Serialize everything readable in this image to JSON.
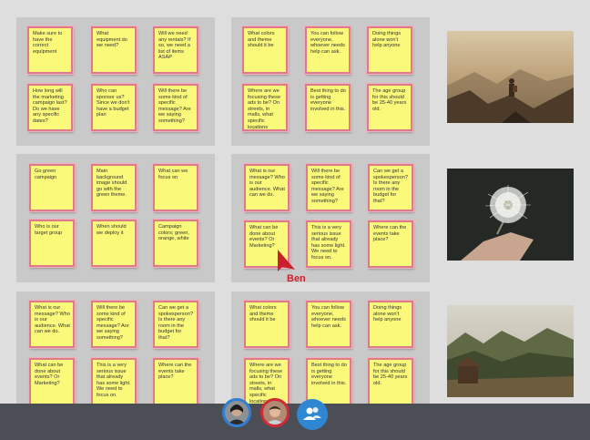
{
  "board": {
    "panels": [
      {
        "notes": [
          "Make sure to have the correct equipment",
          "What equipment do we need?",
          "Will we need any rentals? If so, we need a list of items ASAP",
          "How long will the marketing campaign last? Do we have any specific dates?",
          "Who can sponsor us? Since we don't have a budget plan",
          "Will there be some kind of specific message? Are we saying something?"
        ]
      },
      {
        "notes": [
          "What colors and theme should it be",
          "You can follow everyone, whoever needs help can ask.",
          "Doing things alone won't help anyone",
          "Where are we focusing these ads to be? On streets, in malls, what specific locations",
          "Best thing to do is getting everyone involved in this.",
          "The age group for this should be 25-40 years old."
        ]
      },
      {
        "notes": [
          "Go green campaign",
          "Main background image should go with the green theme.",
          "What can we focus on",
          "Who is our target group",
          "When should we deploy it",
          "Campaign colors; green, orange, white"
        ]
      },
      {
        "notes": [
          "What is our message? Who is our audience. What can we do.",
          "Will there be some kind of specific message? Are we saying something?",
          "Can we get a spokesperson? Is there any room in the budget for that?",
          "What can be done about events? Or Marketing?",
          "This is a very serious issue that already has some light. We need to focus on.",
          "Where can the events take place?"
        ]
      },
      {
        "notes": [
          "What is our message? Who is our audience. What can we do.",
          "Will there be some kind of specific message? Are we saying something?",
          "Can we get a spokesperson? Is there any room in the budget for that?",
          "What can be done about events? Or Marketing?",
          "This is a very serious issue that already has some light. We need to focus on.",
          "Where can the events take place?"
        ]
      },
      {
        "notes": [
          "What colors and theme should it be",
          "You can follow everyone, whoever needs help can ask.",
          "Doing things alone won't help anyone",
          "Where are we focusing these ads to be? On streets, in malls, what specific locations",
          "Best thing to do is getting everyone involved in this.",
          "The age group for this should be 25-40 years old."
        ]
      }
    ],
    "photos": [
      "mountain-hiker-photo",
      "dandelion-photo",
      "forest-cabin-photo"
    ]
  },
  "cursor": {
    "label": "Ben",
    "color": "#cc1f2d"
  },
  "participants": [
    {
      "icon": "participant-avatar",
      "ring": "#2f7fd3"
    },
    {
      "icon": "participant-avatar",
      "ring": "#d22a35"
    },
    {
      "icon": "participants-group-icon",
      "ring": "#2f86d3"
    }
  ],
  "colors": {
    "note": "#fbf97a",
    "note_border": "#e07a8b",
    "panel": "#c9c9c9",
    "toolbar": "#4b4f55"
  }
}
